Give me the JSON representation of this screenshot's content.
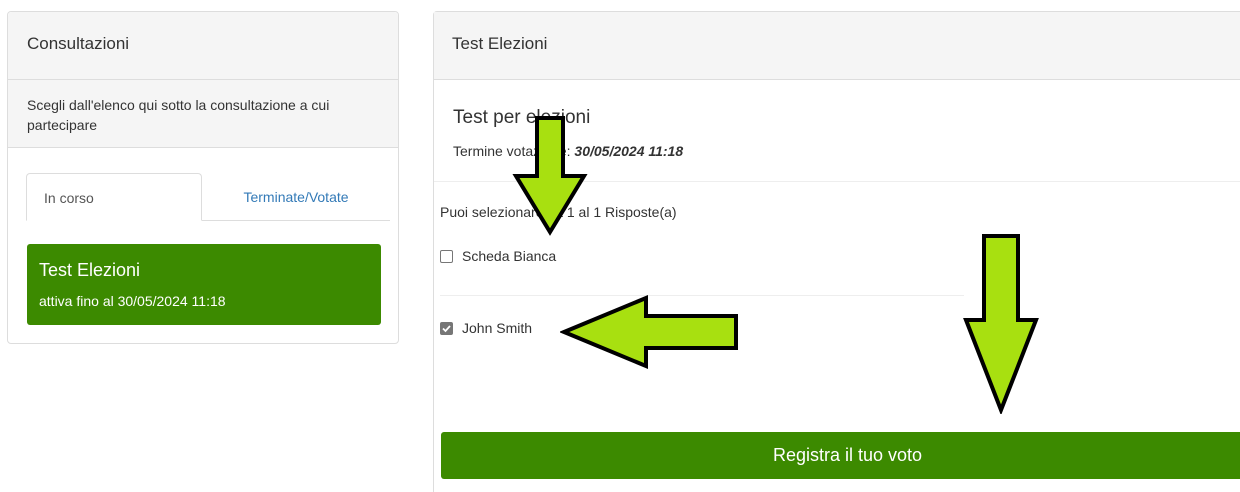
{
  "left_panel": {
    "title": "Consultazioni",
    "description": "Scegli dall'elenco qui sotto la consultazione a cui partecipare",
    "tabs": [
      {
        "label": "In corso",
        "active": true
      },
      {
        "label": "Terminate/Votate",
        "active": false
      }
    ],
    "consultation": {
      "title": "Test Elezioni",
      "subtitle": "attiva fino al 30/05/2024 11:18"
    }
  },
  "right_panel": {
    "header": "Test Elezioni",
    "title": "Test per elezioni",
    "deadline_label": "Termine votazione: ",
    "deadline_value": "30/05/2024 11:18",
    "hint": "Puoi selezionare da 1 al 1 Risposte(a)",
    "options": [
      {
        "label": "Scheda Bianca",
        "checked": false
      },
      {
        "label": "John Smith",
        "checked": true
      }
    ],
    "submit_label": "Registra il tuo voto"
  },
  "annotations": {
    "arrow_color": "#a8e010"
  },
  "colors": {
    "accent_green": "#3c8a00",
    "link_blue": "#337ab7"
  }
}
